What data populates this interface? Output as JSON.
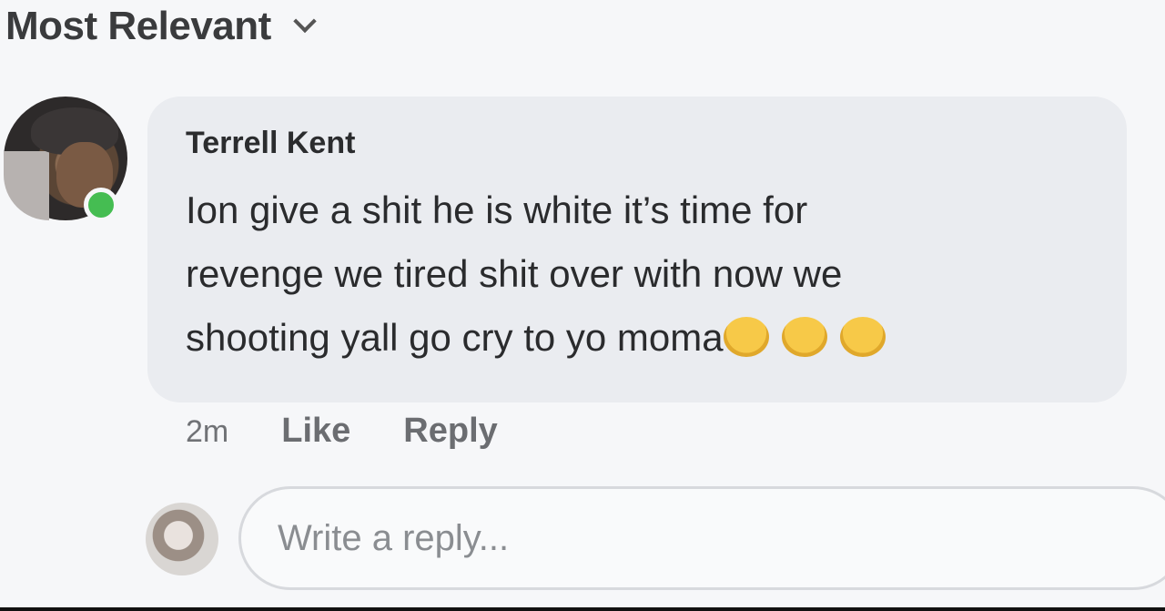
{
  "sort": {
    "label": "Most Relevant"
  },
  "comment": {
    "author": "Terrell Kent",
    "lines": [
      "Ion give a shit he is white it’s time for",
      "revenge we tired shit over with now we",
      "shooting yall go cry to yo moma"
    ],
    "emoji_icons": [
      "laughing-emoji-icon",
      "laughing-emoji-icon",
      "laughing-emoji-icon"
    ],
    "time": "2m",
    "like_label": "Like",
    "reply_label": "Reply",
    "online": true
  },
  "reply_box": {
    "placeholder": "Write a reply..."
  },
  "colors": {
    "bubble": "#eaecf0",
    "online": "#45bd52",
    "meta_text": "#6b6d71"
  }
}
